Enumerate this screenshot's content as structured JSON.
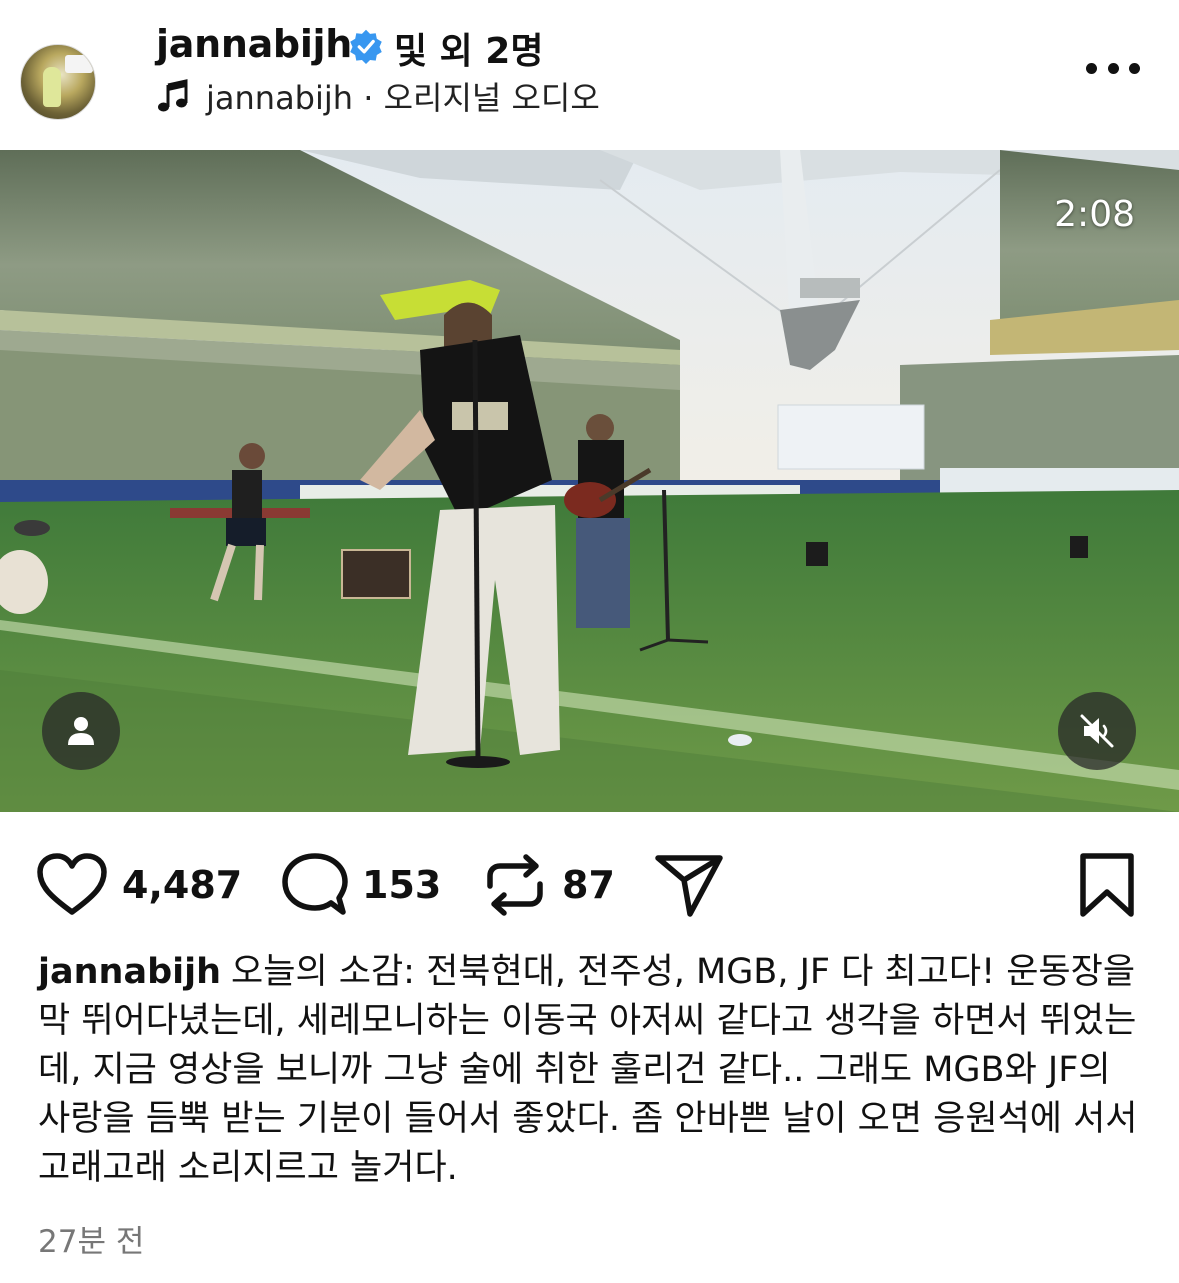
{
  "header": {
    "username": "jannabijh",
    "others": "및 외 2명",
    "audio_text": "jannabijh · 오리지널 오디오"
  },
  "media": {
    "timer": "2:08"
  },
  "actions": {
    "likes": "4,487",
    "comments": "153",
    "reposts": "87"
  },
  "caption": {
    "username": "jannabijh",
    "text": "오늘의 소감: 전북현대, 전주성, MGB, JF 다 최고다! 운동장을 막 뛰어다녔는데, 세레모니하는 이동국 아저씨 같다고 생각을 하면서 뛰었는데, 지금 영상을 보니까 그냥 술에 취한 훌리건 같다.. 그래도 MGB와 JF의 사랑을 듬뿍 받는 기분이 들어서 좋았다. 좀 안바쁜 날이 오면 응원석에 서서 고래고래 소리지르고 놀거다."
  },
  "timestamp": "27분 전",
  "icons": {
    "verified": "verified-badge-icon",
    "music": "music-note-icon",
    "more": "more-icon",
    "tag": "user-tag-icon",
    "mute": "muted-speaker-icon",
    "like": "heart-icon",
    "comment": "comment-icon",
    "repost": "repost-icon",
    "share": "send-icon",
    "save": "bookmark-icon"
  },
  "colors": {
    "verified": "#3897f0",
    "secondary_text": "#777777"
  }
}
